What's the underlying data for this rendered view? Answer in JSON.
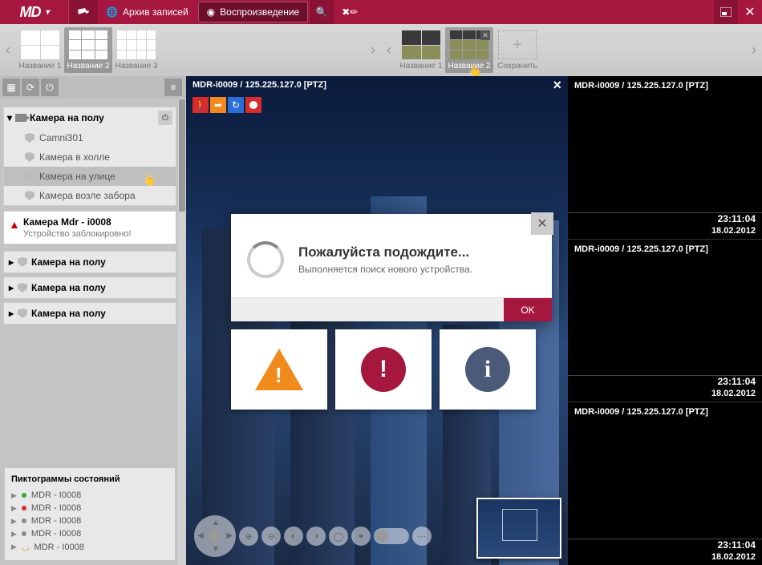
{
  "topbar": {
    "archive_label": "Архив записей",
    "playback_label": "Воспроизведение"
  },
  "layouts_left": [
    {
      "label": "Название 1"
    },
    {
      "label": "Название 2"
    },
    {
      "label": "Название 3"
    }
  ],
  "layouts_right": [
    {
      "label": "Название 1"
    },
    {
      "label": "Название 2"
    },
    {
      "label": "Сохранить"
    }
  ],
  "tree": {
    "group1": {
      "title": "Камера на полу",
      "items": [
        "Camni301",
        "Камера в холле",
        "Камера на улице",
        "Камера возле забора"
      ]
    },
    "alert": {
      "title": "Камера Mdr - i0008",
      "sub": "Устройство заблокировно!"
    },
    "collapsed": [
      "Камера на полу",
      "Камера на полу",
      "Камера на полу"
    ]
  },
  "legend": {
    "title": "Пиктограммы состояний",
    "items": [
      "MDR - I0008",
      "MDR - I0008",
      "MDR - I0008",
      "MDR - I0008",
      "MDR - I0008"
    ]
  },
  "video": {
    "main_title": "MDR-i0009 / 125.225.127.0 [PTZ]",
    "tiles": [
      {
        "title": "MDR-i0009 / 125.225.127.0 [PTZ]",
        "time": "23:11:04",
        "date": "18.02.2012"
      },
      {
        "title": "MDR-i0009 / 125.225.127.0 [PTZ]",
        "time": "23:11:04",
        "date": "18.02.2012"
      },
      {
        "title": "MDR-i0009 / 125.225.127.0 [PTZ]",
        "time": "23:11:04",
        "date": "18.02.2012"
      }
    ]
  },
  "dialog": {
    "title": "Пожалуйста подождите...",
    "sub": "Выполняется поиск нового устройства.",
    "ok": "OK"
  }
}
